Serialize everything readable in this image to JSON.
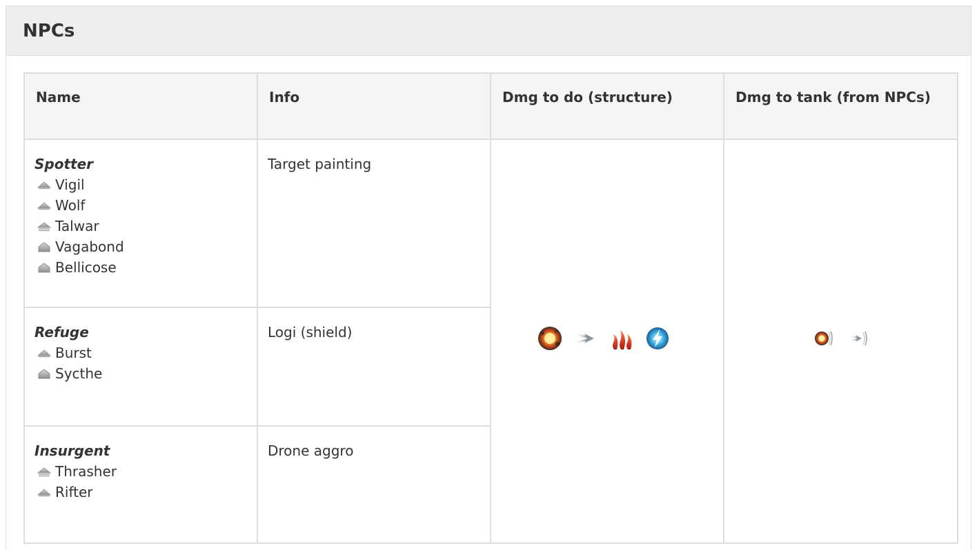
{
  "panel": {
    "title": "NPCs"
  },
  "table": {
    "headers": {
      "name": "Name",
      "info": "Info",
      "dmg_to_do": "Dmg to do (structure)",
      "dmg_to_tank": "Dmg to tank (from NPCs)"
    },
    "rows": [
      {
        "group": "Spotter",
        "info": "Target painting",
        "ships": [
          {
            "name": "Vigil",
            "hull_icon": "frigate-icon"
          },
          {
            "name": "Wolf",
            "hull_icon": "frigate-icon"
          },
          {
            "name": "Talwar",
            "hull_icon": "destroyer-icon"
          },
          {
            "name": "Vagabond",
            "hull_icon": "cruiser-icon"
          },
          {
            "name": "Bellicose",
            "hull_icon": "cruiser-icon"
          }
        ]
      },
      {
        "group": "Refuge",
        "info": "Logi (shield)",
        "ships": [
          {
            "name": "Burst",
            "hull_icon": "frigate-icon"
          },
          {
            "name": "Sycthe",
            "hull_icon": "cruiser-icon"
          }
        ]
      },
      {
        "group": "Insurgent",
        "info": "Drone aggro",
        "ships": [
          {
            "name": "Thrasher",
            "hull_icon": "destroyer-icon"
          },
          {
            "name": "Rifter",
            "hull_icon": "frigate-icon"
          }
        ]
      }
    ],
    "dmg_to_do_icons": [
      "explosive-damage-icon",
      "kinetic-damage-icon",
      "thermal-damage-icon",
      "em-damage-icon"
    ],
    "dmg_to_tank_icons": [
      "explosive-resist-icon",
      "kinetic-resist-icon"
    ]
  },
  "colors": {
    "border": "#dddddd",
    "header_bg": "#eeeeee",
    "thead_bg": "#f5f5f5",
    "text": "#333333"
  }
}
